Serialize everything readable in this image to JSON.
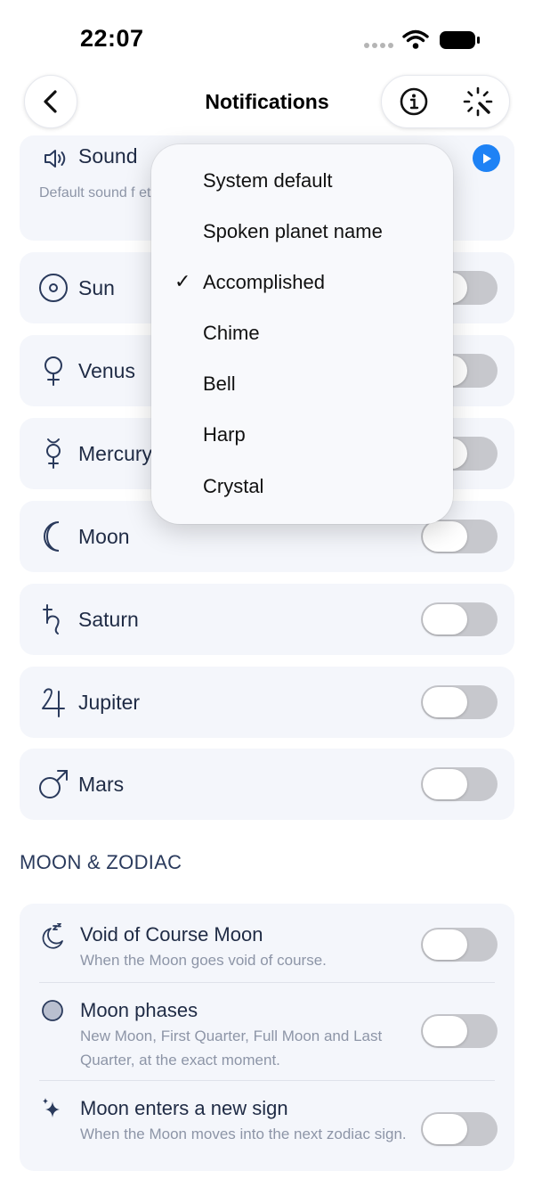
{
  "status": {
    "time": "22:07"
  },
  "nav": {
    "title": "Notifications"
  },
  "sound": {
    "title": "Sound",
    "description": "Default sound f                                                              et can pick its own"
  },
  "planets": [
    {
      "name": "Sun",
      "icon": "sun-symbol-icon",
      "on": false
    },
    {
      "name": "Venus",
      "icon": "venus-symbol-icon",
      "on": false
    },
    {
      "name": "Mercury",
      "icon": "mercury-symbol-icon",
      "on": false
    },
    {
      "name": "Moon",
      "icon": "moon-symbol-icon",
      "on": false
    },
    {
      "name": "Saturn",
      "icon": "saturn-symbol-icon",
      "on": false
    },
    {
      "name": "Jupiter",
      "icon": "jupiter-symbol-icon",
      "on": false
    },
    {
      "name": "Mars",
      "icon": "mars-symbol-icon",
      "on": false
    }
  ],
  "moon_zodiac": {
    "header": "MOON & ZODIAC",
    "items": [
      {
        "title": "Void of Course Moon",
        "description": "When the Moon goes void of course.",
        "icon": "sleeping-moon-icon",
        "on": false
      },
      {
        "title": "Moon phases",
        "description": "New Moon, First Quarter, Full Moon and Last Quarter, at the exact moment.",
        "icon": "moon-disc-icon",
        "on": false
      },
      {
        "title": "Moon enters a new sign",
        "description": "When the Moon moves into the next zodiac sign.",
        "icon": "sparkles-icon",
        "on": false
      }
    ]
  },
  "sound_menu": {
    "options": [
      "System default",
      "Spoken planet name",
      "Accomplished",
      "Chime",
      "Bell",
      "Harp",
      "Crystal"
    ],
    "selected": "Accomplished",
    "check_glyph": "✓"
  },
  "colors": {
    "accent": "#1e82f5",
    "card": "#f4f6fb",
    "toggle_off": "#c7c8cd"
  }
}
